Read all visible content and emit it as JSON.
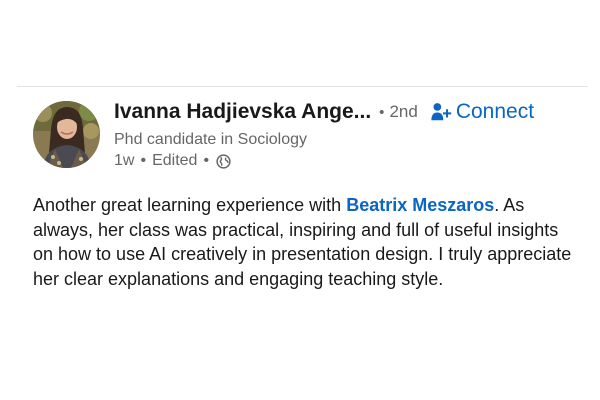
{
  "post": {
    "author": {
      "name": "Ivanna Hadjievska Ange...",
      "degree": "2nd",
      "headline": "Phd candidate in Sociology",
      "avatar_icon": "profile-photo"
    },
    "connect_label": "Connect",
    "connect_icon": "person-add-icon",
    "separator": "•",
    "time": "1w",
    "edited": "Edited",
    "visibility_icon": "globe-icon",
    "body": {
      "before_mention": "Another great learning experience with ",
      "mention": "Beatrix Meszaros",
      "after_mention": ". As always, her class was practical, inspiring and full of useful insights on how to use AI creatively in presentation design. I truly appreciate her clear explanations and engaging teaching style."
    }
  },
  "colors": {
    "link_blue": "#0a66c2",
    "secondary_text": "#666666",
    "primary_text": "#191919",
    "divider": "#e3e3e3"
  }
}
